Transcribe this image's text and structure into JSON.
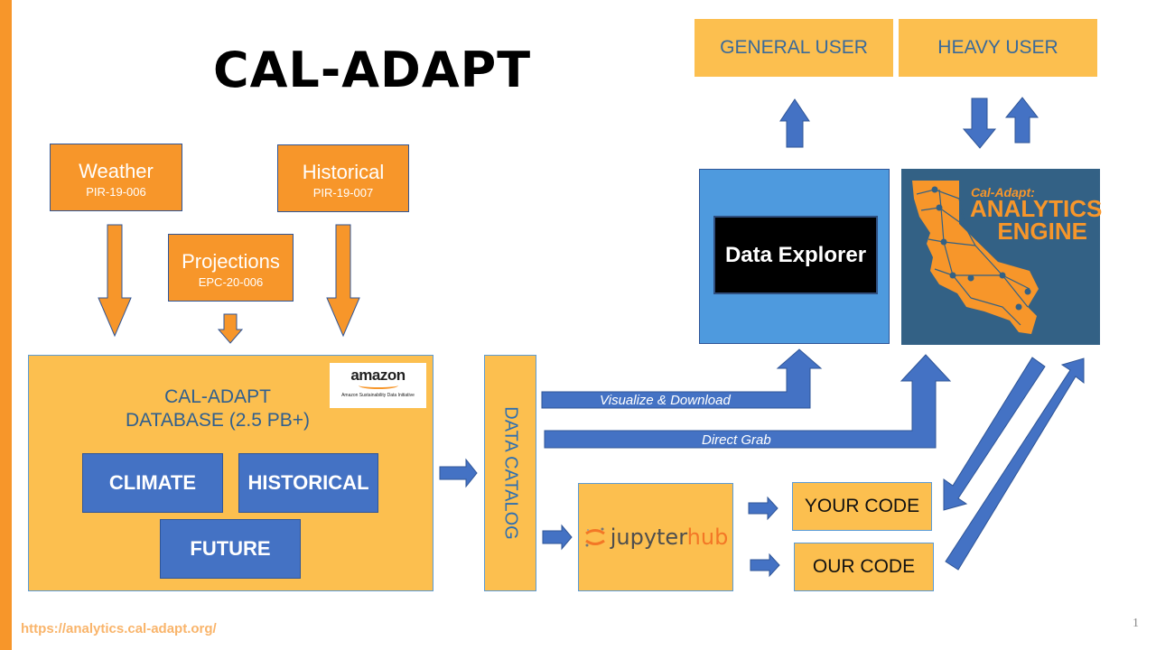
{
  "title": "CAL-ADAPT",
  "sources": [
    {
      "name": "Weather",
      "code": "PIR-19-006"
    },
    {
      "name": "Projections",
      "code": "EPC-20-006"
    },
    {
      "name": "Historical",
      "code": "PIR-19-007"
    }
  ],
  "database": {
    "title_line1": "CAL-ADAPT",
    "title_line2": "DATABASE (2.5 PB+)",
    "partner_logo_word": "amazon",
    "partner_logo_subtitle": "Amazon Sustainability Data Initiative",
    "categories": [
      "CLIMATE",
      "HISTORICAL",
      "FUTURE"
    ]
  },
  "catalog": {
    "label": "DATA CATALOG"
  },
  "flows": {
    "visualize": "Visualize & Download",
    "direct": "Direct Grab"
  },
  "jupyterhub": {
    "part1": "jupyter",
    "part2": "hub"
  },
  "code_boxes": [
    "YOUR CODE",
    "OUR CODE"
  ],
  "users": [
    "GENERAL USER",
    "HEAVY USER"
  ],
  "data_explorer": {
    "label": "Data Explorer"
  },
  "analytics_engine": {
    "line1": "Cal-Adapt:",
    "line2": "ANALYTICS",
    "line3": "ENGINE"
  },
  "footer": {
    "url": "https://analytics.cal-adapt.org/",
    "page_number": "1"
  },
  "colors": {
    "orange": "#f7962a",
    "yellow": "#fcbf4f",
    "blue": "#4472c4",
    "light_blue": "#4e9ade",
    "engine_blue": "#336185"
  }
}
